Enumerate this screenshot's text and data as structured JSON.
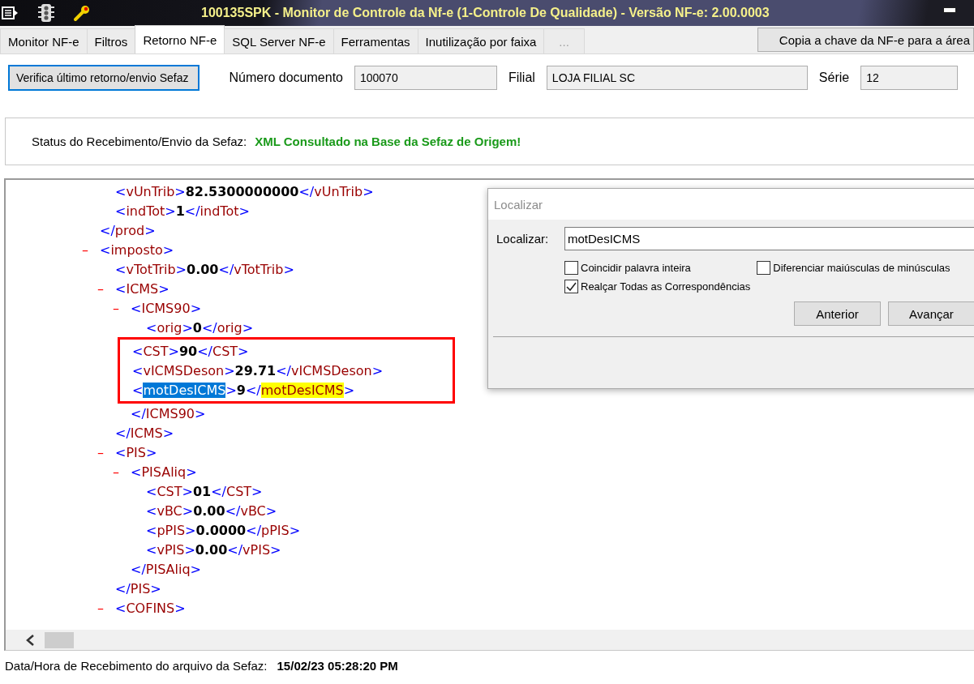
{
  "window": {
    "title": "100135SPK - Monitor de Controle da Nf-e (1-Controle De Qualidade) - Versão NF-e: 2.00.0003"
  },
  "tabs": [
    {
      "label": "Monitor NF-e",
      "selected": false,
      "disabled": false
    },
    {
      "label": "Filtros",
      "selected": false,
      "disabled": false
    },
    {
      "label": "Retorno NF-e",
      "selected": true,
      "disabled": false
    },
    {
      "label": "SQL Server NF-e",
      "selected": false,
      "disabled": false
    },
    {
      "label": "Ferramentas",
      "selected": false,
      "disabled": false
    },
    {
      "label": "Inutilização por faixa",
      "selected": false,
      "disabled": false
    },
    {
      "label": "...",
      "selected": false,
      "disabled": true
    }
  ],
  "copy_button": "Copia a chave da NF-e para a área",
  "check_button": "Verifica último retorno/envio Sefaz",
  "fields": [
    {
      "label": "Número documento",
      "value": "100070"
    },
    {
      "label": "Filial",
      "value": "LOJA FILIAL SC"
    },
    {
      "label": "Série",
      "value": "12"
    }
  ],
  "status": {
    "label": "Status do Recebimento/Envio da Sefaz:",
    "value": "XML Consultado na Base da Sefaz de Origem!"
  },
  "xml_tree": [
    {
      "kind": "element",
      "close": "</prod>",
      "children": [
        {
          "kind": "leaf",
          "open": "<vUnTrib>",
          "value": "82.5300000000",
          "close": "</vUnTrib>"
        },
        {
          "kind": "leaf",
          "open": "<indTot>",
          "value": "1",
          "close": "</indTot>"
        }
      ]
    },
    {
      "kind": "element",
      "toggle": "–",
      "open": "<imposto>",
      "children": [
        {
          "kind": "leaf",
          "open": "<vTotTrib>",
          "value": "0.00",
          "close": "</vTotTrib>"
        },
        {
          "kind": "element",
          "toggle": "–",
          "open": "<ICMS>",
          "close": "</ICMS>",
          "children": [
            {
              "kind": "element",
              "toggle": "–",
              "open": "<ICMS90>",
              "close": "</ICMS90>",
              "children": [
                {
                  "kind": "leaf",
                  "open": "<orig>",
                  "value": "0",
                  "close": "</orig>"
                },
                {
                  "kind": "annotation",
                  "children": [
                    {
                      "kind": "leaf",
                      "open": "<CST>",
                      "value": "90",
                      "close": "</CST>"
                    },
                    {
                      "kind": "leaf",
                      "open": "<vICMSDeson>",
                      "value": "29.71",
                      "close": "</vICMSDeson>"
                    },
                    {
                      "kind": "leaf",
                      "open": [
                        {
                          "text": "<"
                        },
                        {
                          "text": "motDesICMS",
                          "selected": true
                        },
                        {
                          "text": ">"
                        }
                      ],
                      "value": "9",
                      "close": [
                        {
                          "text": "</"
                        },
                        {
                          "text": "motDesICMS",
                          "highlighted": true
                        },
                        {
                          "text": ">"
                        }
                      ]
                    }
                  ]
                }
              ]
            }
          ]
        },
        {
          "kind": "element",
          "toggle": "–",
          "open": "<PIS>",
          "close": "</PIS>",
          "children": [
            {
              "kind": "element",
              "toggle": "–",
              "open": "<PISAliq>",
              "close": "</PISAliq>",
              "children": [
                {
                  "kind": "leaf",
                  "open": "<CST>",
                  "value": "01",
                  "close": "</CST>"
                },
                {
                  "kind": "leaf",
                  "open": "<vBC>",
                  "value": "0.00",
                  "close": "</vBC>"
                },
                {
                  "kind": "leaf",
                  "open": "<pPIS>",
                  "value": "0.0000",
                  "close": "</pPIS>"
                },
                {
                  "kind": "leaf",
                  "open": "<vPIS>",
                  "value": "0.00",
                  "close": "</vPIS>"
                }
              ]
            }
          ]
        },
        {
          "kind": "element",
          "toggle": "–",
          "open": "<COFINS>"
        }
      ]
    }
  ],
  "find_dialog": {
    "title": "Localizar",
    "label": "Localizar:",
    "value": "motDesICMS",
    "options": [
      {
        "label": "Coincidir palavra inteira",
        "checked": false
      },
      {
        "label": "Diferenciar maiúsculas de minúsculas",
        "checked": false
      },
      {
        "label": "Realçar Todas as Correspondências",
        "checked": true
      }
    ],
    "buttons": [
      "Anterior",
      "Avançar"
    ]
  },
  "footer": {
    "label": "Data/Hora de Recebimento do arquivo da Sefaz:",
    "value": "15/02/23 05:28:20 PM"
  }
}
